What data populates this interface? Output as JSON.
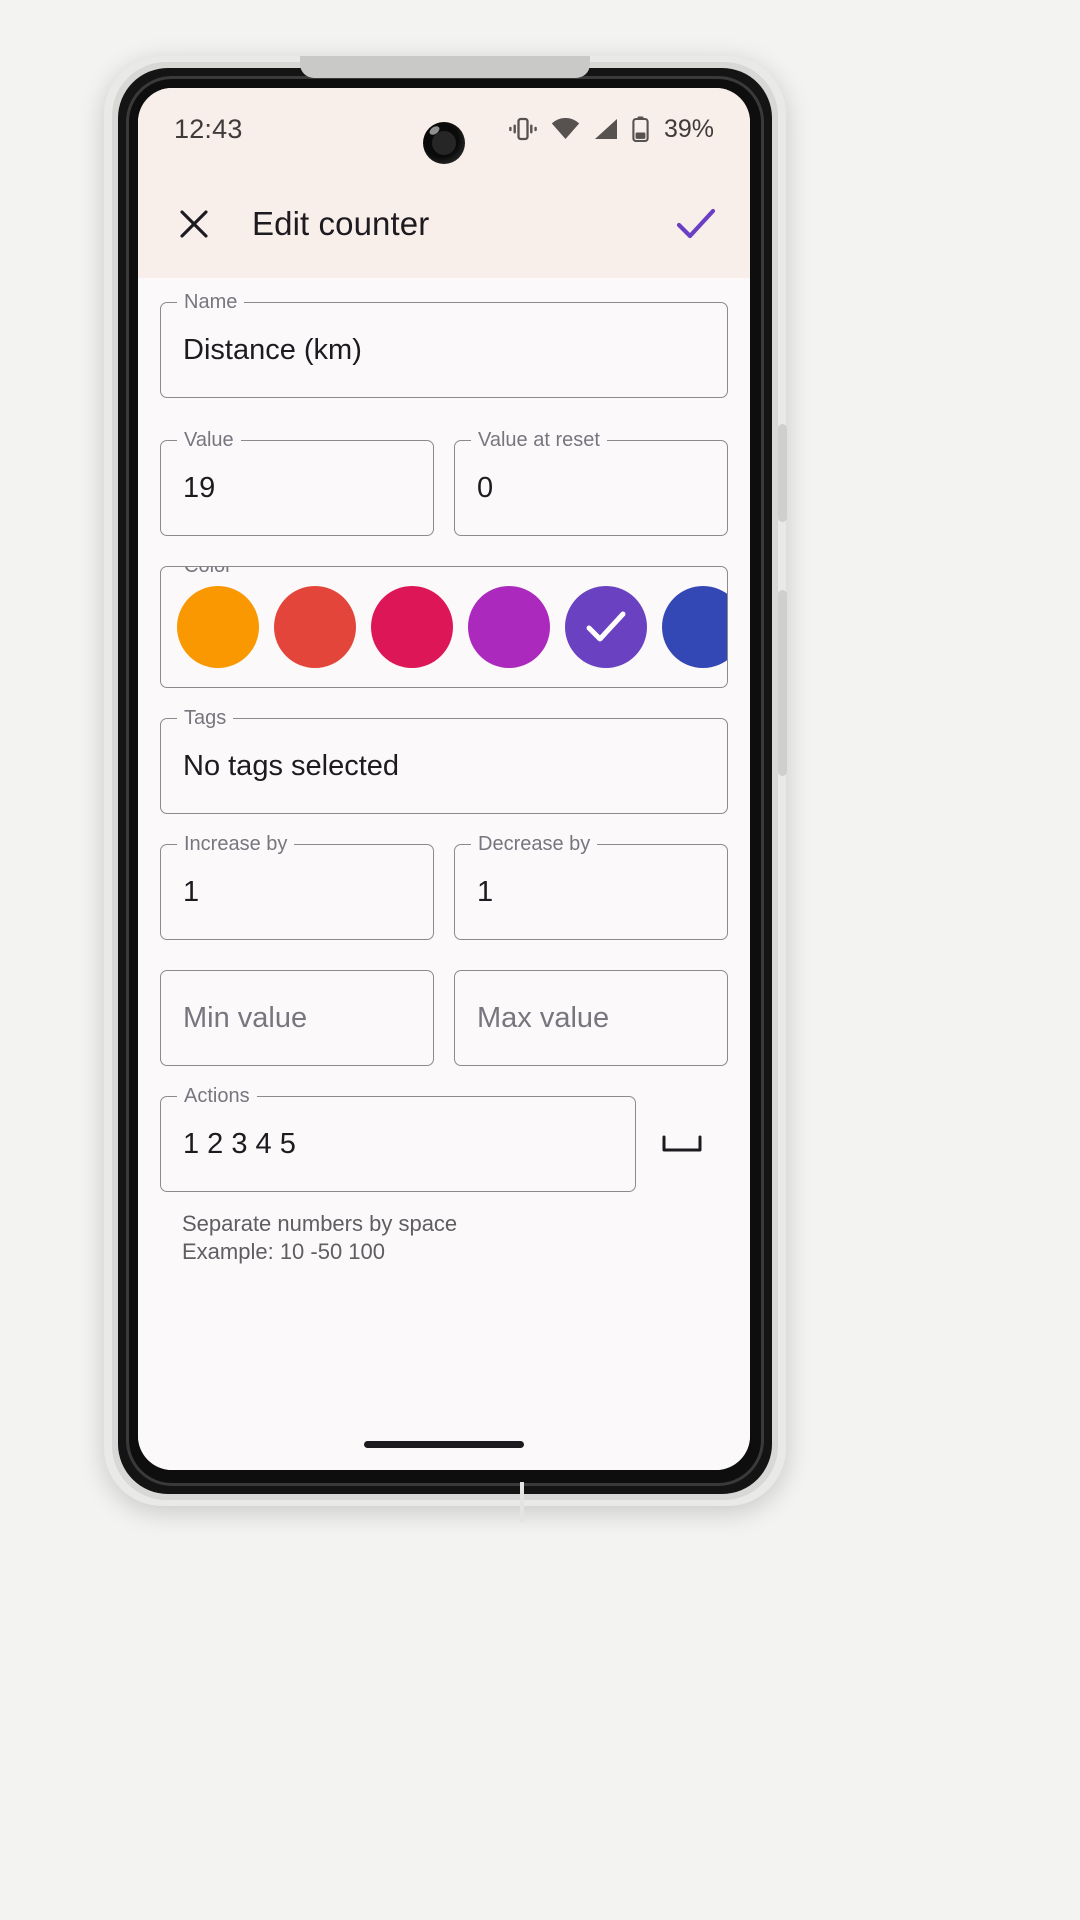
{
  "status_bar": {
    "time": "12:43",
    "battery_percent": "39%",
    "icons": [
      "vibrate-icon",
      "wifi-icon",
      "cellular-signal-icon",
      "battery-icon"
    ]
  },
  "app_bar": {
    "close_label": "✕",
    "title": "Edit counter",
    "confirm_label": "✓",
    "accent_color": "#6a3fc4",
    "background": "#f8eeea"
  },
  "form": {
    "name": {
      "label": "Name",
      "value": "Distance (km)",
      "placeholder": "Name"
    },
    "value": {
      "label": "Value",
      "value": "19",
      "placeholder": "Value"
    },
    "value_at_reset": {
      "label": "Value at reset",
      "value": "0",
      "placeholder": "Value at reset"
    },
    "color": {
      "label": "Color",
      "selected_index": 4,
      "swatches": [
        {
          "name": "orange",
          "hex": "#f99800"
        },
        {
          "name": "red",
          "hex": "#e4453a"
        },
        {
          "name": "crimson",
          "hex": "#dd1757"
        },
        {
          "name": "magenta",
          "hex": "#ab29bd"
        },
        {
          "name": "violet",
          "hex": "#6a41c0"
        },
        {
          "name": "indigo",
          "hex": "#3448b5"
        },
        {
          "name": "blue",
          "hex": "#1184e2"
        }
      ]
    },
    "tags": {
      "label": "Tags",
      "value": "No tags selected",
      "placeholder": "Tags"
    },
    "increase_by": {
      "label": "Increase by",
      "value": "1",
      "placeholder": "Increase by"
    },
    "decrease_by": {
      "label": "Decrease by",
      "value": "1",
      "placeholder": "Decrease by"
    },
    "min_value": {
      "label": "",
      "value": "",
      "placeholder": "Min value"
    },
    "max_value": {
      "label": "",
      "value": "",
      "placeholder": "Max value"
    },
    "actions": {
      "label": "Actions",
      "value": "1 2 3 4 5",
      "placeholder": "Actions",
      "space_button_name": "space-bar-icon",
      "helper_line_1": "Separate numbers by space",
      "helper_line_2": "Example: 10 -50 100"
    }
  },
  "nav_bar": {
    "gesture_pill": "home-indicator"
  }
}
